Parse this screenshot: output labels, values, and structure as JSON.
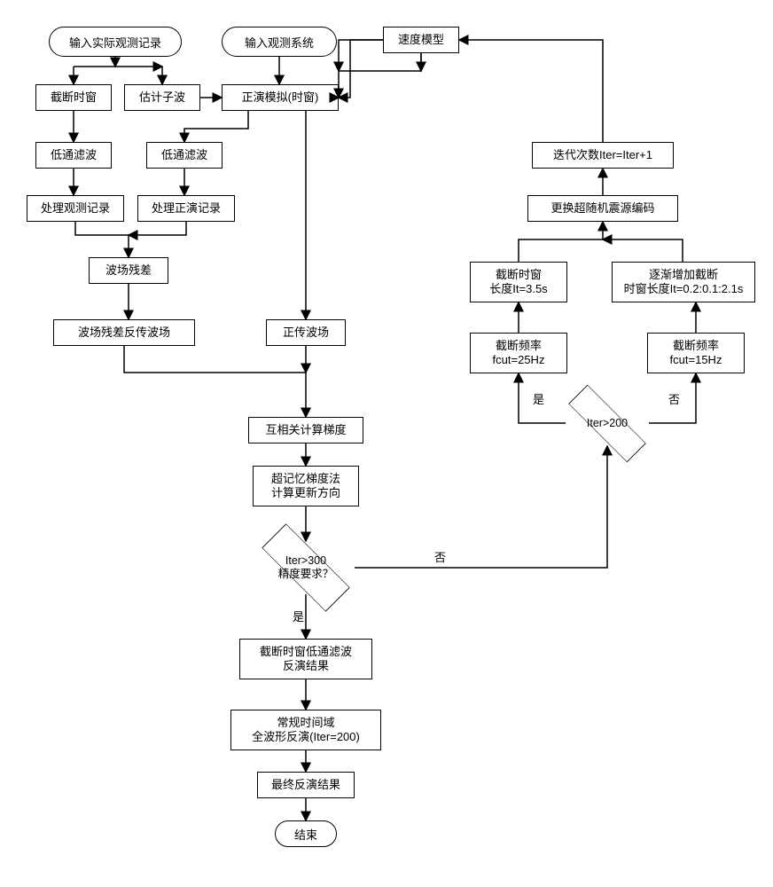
{
  "chart_data": {
    "type": "flowchart",
    "nodes": [
      {
        "id": "n_input_obs",
        "shape": "terminal",
        "label": "输入实际观测记录"
      },
      {
        "id": "n_input_sys",
        "shape": "terminal",
        "label": "输入观测系统"
      },
      {
        "id": "n_trunc_win",
        "shape": "box",
        "label": "截断时窗"
      },
      {
        "id": "n_est_wavelet",
        "shape": "box",
        "label": "估计子波"
      },
      {
        "id": "n_forward",
        "shape": "box",
        "label": "正演模拟(时窗)"
      },
      {
        "id": "n_velocity",
        "shape": "box",
        "label": "速度模型"
      },
      {
        "id": "n_low1",
        "shape": "box",
        "label": "低通滤波"
      },
      {
        "id": "n_low2",
        "shape": "box",
        "label": "低通滤波"
      },
      {
        "id": "n_proc_obs",
        "shape": "box",
        "label": "处理观测记录"
      },
      {
        "id": "n_proc_fwd",
        "shape": "box",
        "label": "处理正演记录"
      },
      {
        "id": "n_residual",
        "shape": "box",
        "label": "波场残差"
      },
      {
        "id": "n_backprop",
        "shape": "box",
        "label": "波场残差反传波场"
      },
      {
        "id": "n_forward_field",
        "shape": "box",
        "label": "正传波场"
      },
      {
        "id": "n_crosscorr",
        "shape": "box",
        "label": "互相关计算梯度"
      },
      {
        "id": "n_memory_grad",
        "shape": "box",
        "label": "超记忆梯度法\n计算更新方向"
      },
      {
        "id": "d300",
        "shape": "diamond",
        "label": "Iter>300\n精度要求？"
      },
      {
        "id": "n_trunc_result",
        "shape": "box",
        "label": "截断时窗低通滤波\n反演结果"
      },
      {
        "id": "n_conventional",
        "shape": "box",
        "label": "常规时间域\n全波形反演(Iter=200)"
      },
      {
        "id": "n_final",
        "shape": "box",
        "label": "最终反演结果"
      },
      {
        "id": "n_end",
        "shape": "terminal",
        "label": "结束"
      },
      {
        "id": "d200",
        "shape": "diamond",
        "label": "Iter>200"
      },
      {
        "id": "n_fcut25",
        "shape": "box",
        "label": "截断频率\nfcut=25Hz"
      },
      {
        "id": "n_fcut15",
        "shape": "box",
        "label": "截断频率\nfcut=15Hz"
      },
      {
        "id": "n_win35",
        "shape": "box",
        "label": "截断时窗\n长度It=3.5s"
      },
      {
        "id": "n_win_grow",
        "shape": "box",
        "label": "逐渐增加截断\n时窗长度It=0.2:0.1:2.1s"
      },
      {
        "id": "n_change_src",
        "shape": "box",
        "label": "更换超随机震源编码"
      },
      {
        "id": "n_iter_inc",
        "shape": "box",
        "label": "迭代次数Iter=Iter+1"
      }
    ],
    "edges": [
      {
        "from": "n_input_obs",
        "to": "n_trunc_win"
      },
      {
        "from": "n_input_obs",
        "to": "n_est_wavelet"
      },
      {
        "from": "n_input_sys",
        "to": "n_forward"
      },
      {
        "from": "n_est_wavelet",
        "to": "n_forward"
      },
      {
        "from": "n_velocity",
        "to": "n_forward"
      },
      {
        "from": "n_trunc_win",
        "to": "n_low1"
      },
      {
        "from": "n_low1",
        "to": "n_proc_obs"
      },
      {
        "from": "n_forward",
        "to": "n_low2"
      },
      {
        "from": "n_low2",
        "to": "n_proc_fwd"
      },
      {
        "from": "n_proc_obs",
        "to": "n_residual"
      },
      {
        "from": "n_proc_fwd",
        "to": "n_residual"
      },
      {
        "from": "n_residual",
        "to": "n_backprop"
      },
      {
        "from": "n_backprop",
        "to": "n_crosscorr"
      },
      {
        "from": "n_forward",
        "to": "n_forward_field"
      },
      {
        "from": "n_forward_field",
        "to": "n_crosscorr"
      },
      {
        "from": "n_crosscorr",
        "to": "n_memory_grad"
      },
      {
        "from": "n_memory_grad",
        "to": "d300"
      },
      {
        "from": "d300",
        "to": "n_trunc_result",
        "label": "是"
      },
      {
        "from": "d300",
        "to": "d200",
        "label": "否"
      },
      {
        "from": "d200",
        "to": "n_fcut25",
        "label": "是"
      },
      {
        "from": "d200",
        "to": "n_fcut15",
        "label": "否"
      },
      {
        "from": "n_fcut25",
        "to": "n_win35"
      },
      {
        "from": "n_fcut15",
        "to": "n_win_grow"
      },
      {
        "from": "n_win35",
        "to": "n_change_src"
      },
      {
        "from": "n_win_grow",
        "to": "n_change_src"
      },
      {
        "from": "n_change_src",
        "to": "n_iter_inc"
      },
      {
        "from": "n_iter_inc",
        "to": "n_velocity"
      },
      {
        "from": "n_trunc_result",
        "to": "n_conventional"
      },
      {
        "from": "n_conventional",
        "to": "n_final"
      },
      {
        "from": "n_final",
        "to": "n_end"
      }
    ],
    "edge_labels": {
      "yes": "是",
      "no": "否"
    }
  }
}
